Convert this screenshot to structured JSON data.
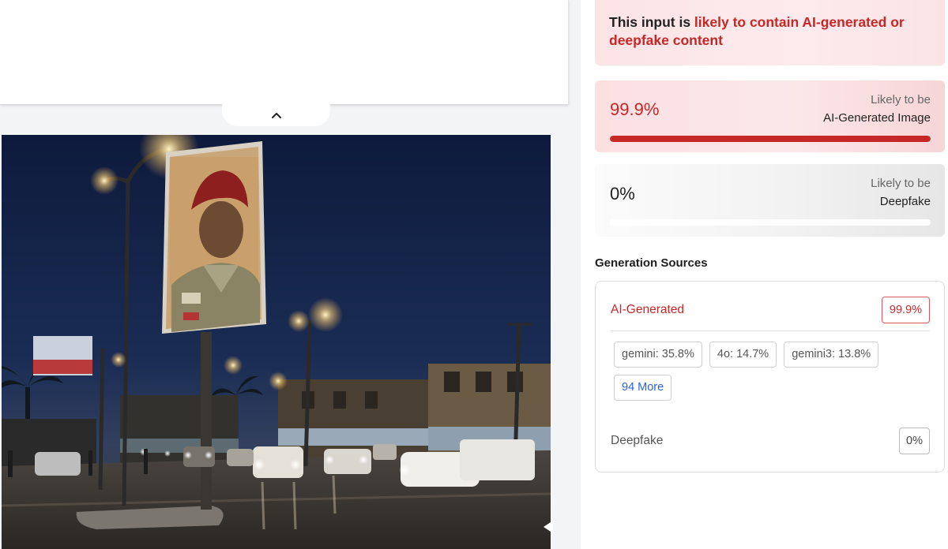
{
  "verdict": {
    "prefix": "This input is ",
    "highlight": "likely to contain AI-generated or deepfake content"
  },
  "scores": {
    "ai": {
      "value_text": "99.9%",
      "fill_fraction": 0.999,
      "label_line1": "Likely to be",
      "label_line2": "AI-Generated Image"
    },
    "deepfake": {
      "value_text": "0%",
      "fill_fraction": 0,
      "label_line1": "Likely to be",
      "label_line2": "Deepfake"
    }
  },
  "sources": {
    "title": "Generation Sources",
    "ai_row": {
      "label": "AI-Generated",
      "value": "99.9%"
    },
    "chips": [
      "gemini: 35.8%",
      "4o: 14.7%",
      "gemini3: 13.8%"
    ],
    "more_label": "94 More",
    "deepfake_row": {
      "label": "Deepfake",
      "value": "0%"
    }
  },
  "icons": {
    "collapse": "chevron-up-icon"
  },
  "colors": {
    "accent_red": "#c62828",
    "link_blue": "#2a64d6"
  }
}
